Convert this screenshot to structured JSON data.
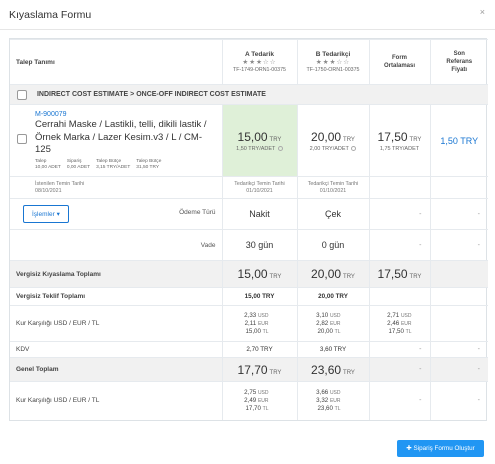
{
  "modal": {
    "title": "Kıyaslama Formu",
    "close": "×"
  },
  "header": {
    "request_definition": "Talep Tanımı",
    "supplier_a": {
      "name": "A Tedarik",
      "stars": "★★★☆☆",
      "code": "TF-1749-ORN1-00375"
    },
    "supplier_b": {
      "name": "B Tedarikçi",
      "stars": "★★★☆☆",
      "code": "TF-1750-ORN1-00375"
    },
    "form_avg": [
      "Form",
      "Ortalaması"
    ],
    "last_ref": [
      "Son",
      "Referans",
      "Fiyatı"
    ]
  },
  "category": {
    "label": "INDIRECT COST ESTIMATE > ONCE-OFF INDIRECT COST ESTIMATE"
  },
  "item": {
    "code": "M-900079",
    "name_line1": "Cerrahi Maske / Lastikli, telli, dikili lastik /",
    "name_line2": "Örnek Marka / Lazer Kesim.v3 / L / CM-125",
    "meta": [
      {
        "label": "Talep",
        "value": "10,00 ADET"
      },
      {
        "label": "Sipariş",
        "value": "0,00 ADET"
      },
      {
        "label": "Talep Bütçe",
        "value": "3,15 TRY/ADET"
      },
      {
        "label": "Talep Bütçe",
        "value": "31,50 TRY"
      }
    ],
    "prices": {
      "a": {
        "amount": "15,00",
        "currency": "TRY",
        "unit": "1,50 TRY/ADET"
      },
      "b": {
        "amount": "20,00",
        "currency": "TRY",
        "unit": "2,00 TRY/ADET"
      },
      "avg": {
        "amount": "17,50",
        "currency": "TRY",
        "unit": "1,75 TRY/ADET"
      },
      "ref": "1,50 TRY"
    },
    "dates": {
      "request_label": "İstenilen Temin Tarihi",
      "request_date": "08/10/2021",
      "a_label": "Tedarikçi Temin Tarihi",
      "a_date": "01/10/2021",
      "b_label": "Tedarikçi Temin Tarihi",
      "b_date": "01/10/2021"
    }
  },
  "payment": {
    "actions_label": "İşlemler",
    "label": "Ödeme Türü",
    "a": "Nakit",
    "b": "Çek",
    "avg": "-",
    "ref": "-"
  },
  "term": {
    "label": "Vade",
    "a": "30 gün",
    "b": "0 gün",
    "avg": "-",
    "ref": "-"
  },
  "totals": {
    "compare_label": "Vergisiz Kıyaslama Toplamı",
    "compare_a": "15,00",
    "compare_b": "20,00",
    "compare_avg": "17,50",
    "currency": "TRY",
    "offer_label": "Vergisiz Teklif Toplamı",
    "offer_a": "15,00 TRY",
    "offer_b": "20,00 TRY",
    "fx_label": "Kur Karşılığı USD / EUR / TL",
    "fx_a": [
      [
        "2,33",
        "USD"
      ],
      [
        "2,11",
        "EUR"
      ],
      [
        "15,00",
        "TL"
      ]
    ],
    "fx_b": [
      [
        "3,10",
        "USD"
      ],
      [
        "2,82",
        "EUR"
      ],
      [
        "20,00",
        "TL"
      ]
    ],
    "fx_avg": [
      [
        "2,71",
        "USD"
      ],
      [
        "2,46",
        "EUR"
      ],
      [
        "17,50",
        "TL"
      ]
    ],
    "vat_label": "KDV",
    "vat_a": "2,70 TRY",
    "vat_b": "3,60 TRY",
    "grand_label": "Genel Toplam",
    "grand_a": "17,70",
    "grand_b": "23,60",
    "fx2_label": "Kur Karşılığı USD / EUR / TL",
    "fx2_a": [
      [
        "2,75",
        "USD"
      ],
      [
        "2,49",
        "EUR"
      ],
      [
        "17,70",
        "TL"
      ]
    ],
    "fx2_b": [
      [
        "3,66",
        "USD"
      ],
      [
        "3,32",
        "EUR"
      ],
      [
        "23,60",
        "TL"
      ]
    ],
    "dash": "-"
  },
  "footer": {
    "order_button": "Sipariş Formu Oluştur"
  }
}
